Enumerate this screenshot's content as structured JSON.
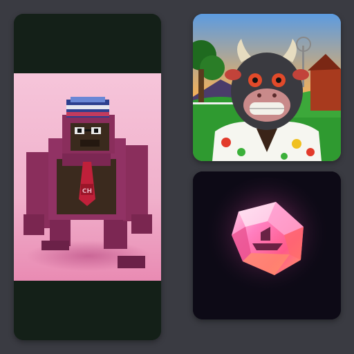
{
  "gallery": {
    "items": [
      {
        "id": "gorilla",
        "kind": "nft-art",
        "subject": "voxel-gorilla",
        "badge_text": "CH"
      },
      {
        "id": "bull",
        "kind": "nft-art",
        "subject": "cartoon-bull"
      },
      {
        "id": "gem",
        "kind": "nft-art",
        "subject": "pink-crystal-gem"
      }
    ]
  },
  "colors": {
    "page_background": "#3a3b42",
    "gorilla_frame": "#142018",
    "gorilla_backdrop": "#f0b2cd",
    "gorilla_body": "#8a2e5c",
    "bull_sky": "#4f8fd6",
    "bull_grass": "#2f9a30",
    "gem_background": "#0d0a16",
    "gem_pink": "#ff6fb4"
  }
}
